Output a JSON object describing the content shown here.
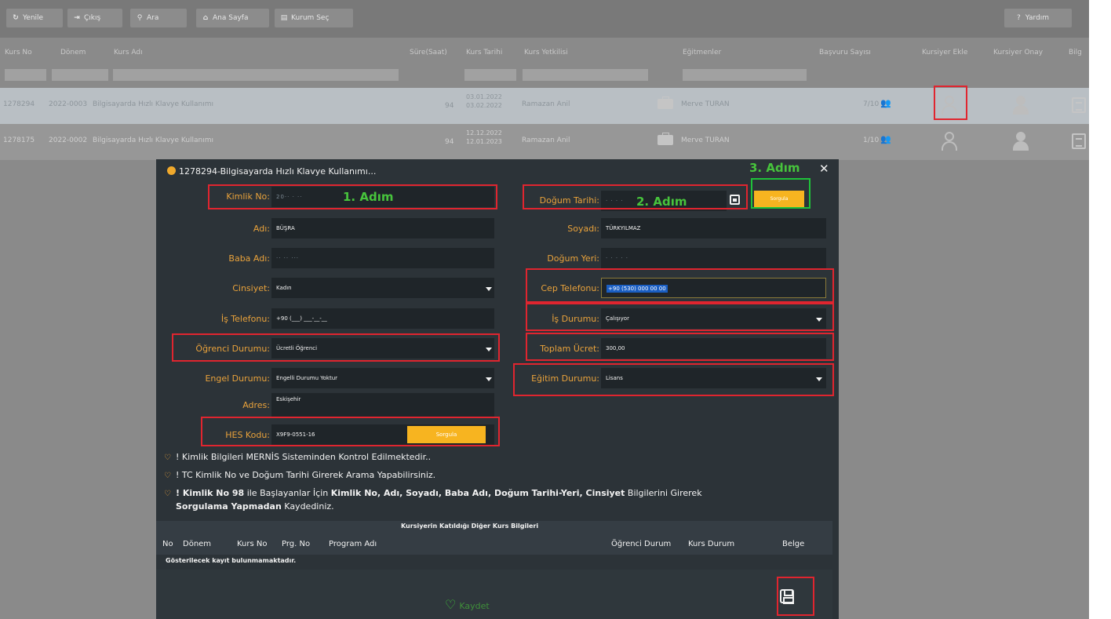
{
  "toolbar": {
    "buttons": [
      {
        "label": "Yenile",
        "icon": "refresh-icon"
      },
      {
        "label": "Çıkış",
        "icon": "exit-icon"
      },
      {
        "label": "Ara",
        "icon": "search-icon"
      },
      {
        "label": "Ana Sayfa",
        "icon": "home-icon"
      },
      {
        "label": "Kurum Seç",
        "icon": "institution-icon"
      }
    ],
    "help_label": "Yardım"
  },
  "grid": {
    "columns": [
      "Kurs No",
      "Dönem",
      "Kurs Adı",
      "Süre(Saat)",
      "Kurs Tarihi",
      "Kurs Yetkilisi",
      "Eğitmenler",
      "Başvuru Sayısı",
      "Kursiyer Ekle",
      "Kursiyer Onay",
      "Bilg"
    ],
    "rows": [
      {
        "kurs_no": "1278294",
        "donem": "2022-0003",
        "kurs_adi": "Bilgisayarda Hızlı Klavye Kullanımı",
        "sure": "94",
        "tarih_bas": "03.01.2022",
        "tarih_bit": "03.02.2022",
        "yetkili": "Ramazan Anil",
        "egitmen": "Merve TURAN",
        "basvuru": "7/10"
      },
      {
        "kurs_no": "1278175",
        "donem": "2022-0002",
        "kurs_adi": "Bilgisayarda Hızlı Klavye Kullanımı",
        "sure": "94",
        "tarih_bas": "12.12.2022",
        "tarih_bit": "12.01.2023",
        "yetkili": "Ramazan Anil",
        "egitmen": "Merve TURAN",
        "basvuru": "1/10"
      }
    ]
  },
  "dialog": {
    "title": "1278294-Bilgisayarda Hızlı Klavye Kullanımı...",
    "labels": {
      "kimlik_no": "Kimlik No:",
      "adi": "Adı:",
      "baba_adi": "Baba Adı:",
      "cinsiyet": "Cinsiyet:",
      "is_telefonu": "İş Telefonu:",
      "ogrenci_durumu": "Öğrenci Durumu:",
      "engel_durumu": "Engel Durumu:",
      "adres": "Adres:",
      "hes_kodu": "HES Kodu:",
      "dogum_tarihi": "Doğum Tarihi:",
      "soyadi": "Soyadı:",
      "dogum_yeri": "Doğum Yeri:",
      "cep_telefonu": "Cep Telefonu:",
      "is_durumu": "İş Durumu:",
      "toplam_ucret": "Toplam Ücret:",
      "egitim_durumu": "Eğitim Durumu:"
    },
    "values": {
      "kimlik_no": "20·· ·  ··",
      "adi": "BÜŞRA",
      "baba_adi": "·· ·· ···",
      "cinsiyet": "Kadın",
      "is_telefonu": "+90 (___) ___-__-__",
      "ogrenci_durumu": "Ücretli Öğrenci",
      "engel_durumu": "Engelli Durumu Yoktur",
      "adres": "Eskişehir",
      "hes_kodu": "X9F9-0551-16",
      "dogum_tarihi": "· · · ·",
      "soyadi": "TÜRKYILMAZ",
      "dogum_yeri": "· · · · ·",
      "cep_telefonu": "+90 (530) 000 00 00",
      "is_durumu": "Çalışıyor",
      "toplam_ucret": "300,00",
      "egitim_durumu": "Lisans"
    },
    "steps": {
      "step1": "1. Adım",
      "step2": "2. Adım",
      "step3": "3. Adım"
    },
    "sorgula_label": "Sorgula",
    "hes_sorgula_label": "Sorgula",
    "notes": {
      "n1": "! Kimlik Bilgileri MERNİS Sisteminden Kontrol Edilmektedir..",
      "n2": "! TC Kimlik No ve Doğum Tarihi Girerek Arama Yapabilirsiniz.",
      "n3_a": "! Kimlik No 98",
      "n3_b": " ile Başlayanlar İçin ",
      "n3_c": "Kimlik No, Adı, Soyadı, Baba Adı, Doğum Tarihi-Yeri, Cinsiyet",
      "n3_d": " Bilgilerini Girerek",
      "n3_e": "Sorgulama Yapmadan",
      "n3_f": " Kaydediniz."
    },
    "sub_table": {
      "title": "Kursiyerin Katıldığı Diğer Kurs Bilgileri",
      "columns": [
        "No",
        "Dönem",
        "Kurs No",
        "Prg. No",
        "Program Adı",
        "Öğrenci Durum",
        "Kurs Durum",
        "Belge"
      ],
      "empty_message": "Gösterilecek kayıt bulunmamaktadır."
    },
    "save_label": "Kaydet"
  }
}
